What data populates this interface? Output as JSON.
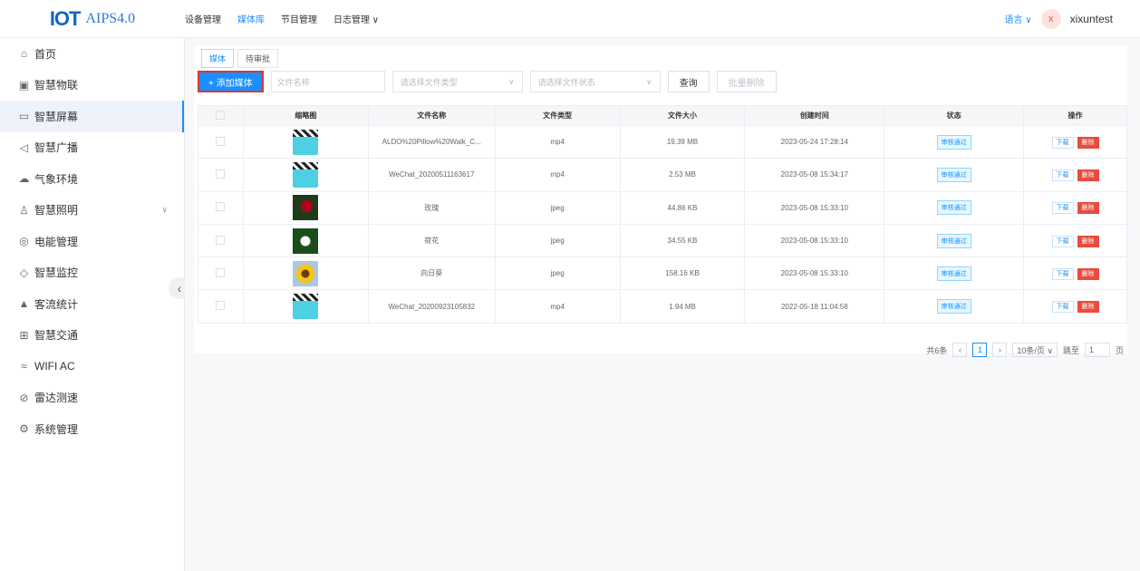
{
  "header": {
    "logo_mark": "IOT",
    "logo_text": "AIPS4.0",
    "nav": [
      {
        "label": "设备管理",
        "active": false
      },
      {
        "label": "媒体库",
        "active": true
      },
      {
        "label": "节目管理",
        "active": false
      },
      {
        "label": "日志管理 ∨",
        "active": false
      }
    ],
    "language": "语言 ∨",
    "avatar_initial": "x",
    "username": "xixuntest"
  },
  "sidebar": {
    "items": [
      {
        "icon": "home-icon",
        "glyph": "⌂",
        "label": "首页"
      },
      {
        "icon": "iot-icon",
        "glyph": "▣",
        "label": "智慧物联"
      },
      {
        "icon": "screen-icon",
        "glyph": "▭",
        "label": "智慧屏幕"
      },
      {
        "icon": "broadcast-icon",
        "glyph": "◁",
        "label": "智慧广播"
      },
      {
        "icon": "weather-icon",
        "glyph": "☁",
        "label": "气象环境"
      },
      {
        "icon": "lighting-icon",
        "glyph": "♙",
        "label": "智慧照明"
      },
      {
        "icon": "energy-icon",
        "glyph": "◎",
        "label": "电能管理"
      },
      {
        "icon": "camera-icon",
        "glyph": "◇",
        "label": "智慧监控"
      },
      {
        "icon": "stats-icon",
        "glyph": "▲",
        "label": "客流统计"
      },
      {
        "icon": "traffic-icon",
        "glyph": "⊞",
        "label": "智慧交通"
      },
      {
        "icon": "wifi-icon",
        "glyph": "≈",
        "label": "WIFI AC"
      },
      {
        "icon": "radar-icon",
        "glyph": "⊘",
        "label": "雷达测速"
      },
      {
        "icon": "settings-icon",
        "glyph": "⚙",
        "label": "系统管理"
      }
    ],
    "active_index": 2,
    "expandable_index": 5,
    "collapse_glyph": "‹"
  },
  "tabs": [
    {
      "label": "媒体",
      "active": true
    },
    {
      "label": "待审批",
      "active": false
    }
  ],
  "toolbar": {
    "add_label": "+ 添加媒体",
    "name_placeholder": "文件名称",
    "type_placeholder": "请选择文件类型",
    "status_placeholder": "请选择文件状态",
    "query_label": "查询",
    "batch_delete_label": "批量删除"
  },
  "table": {
    "columns": [
      "缩略图",
      "文件名称",
      "文件类型",
      "文件大小",
      "创建时间",
      "状态",
      "操作"
    ],
    "rows": [
      {
        "thumb": "video",
        "name": "ALDO%20Pillow%20Walk_C...",
        "type": "mp4",
        "size": "19.39 MB",
        "created": "2023-05-24 17:28:14",
        "status": "审核通过"
      },
      {
        "thumb": "video",
        "name": "WeChat_20200511163617",
        "type": "mp4",
        "size": "2.53 MB",
        "created": "2023-05-08 15:34:17",
        "status": "审核通过"
      },
      {
        "thumb": "rose",
        "name": "玫瑰",
        "type": "jpeg",
        "size": "44.86 KB",
        "created": "2023-05-08 15:33:10",
        "status": "审核通过"
      },
      {
        "thumb": "lotus",
        "name": "荷花",
        "type": "jpeg",
        "size": "34.55 KB",
        "created": "2023-05-08 15:33:10",
        "status": "审核通过"
      },
      {
        "thumb": "sunflower",
        "name": "向日葵",
        "type": "jpeg",
        "size": "158.16 KB",
        "created": "2023-05-08 15:33:10",
        "status": "审核通过"
      },
      {
        "thumb": "video",
        "name": "WeChat_20200923105832",
        "type": "mp4",
        "size": "1.94 MB",
        "created": "2022-05-18 11:04:58",
        "status": "审核通过"
      }
    ],
    "download_label": "下载",
    "delete_label": "删除"
  },
  "pagination": {
    "total": "共6条",
    "prev": "‹",
    "current": "1",
    "next": "›",
    "page_size": "10条/页 ∨",
    "goto_label": "跳至",
    "goto_value": "1",
    "page_unit": "页"
  }
}
